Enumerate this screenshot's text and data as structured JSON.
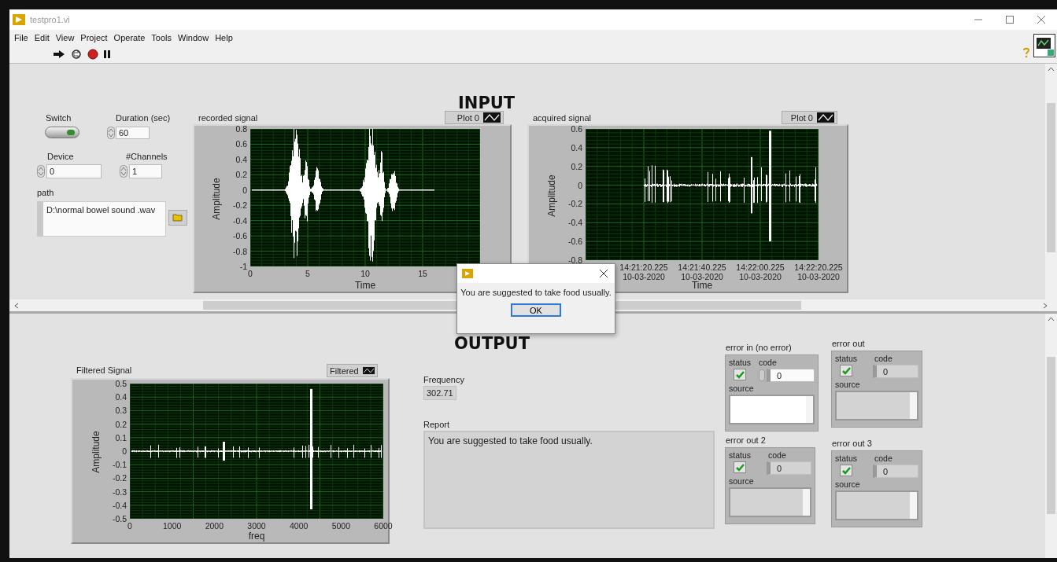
{
  "window": {
    "title": "testpro1.vi"
  },
  "menu": [
    "File",
    "Edit",
    "View",
    "Project",
    "Operate",
    "Tools",
    "Window",
    "Help"
  ],
  "input": {
    "heading": "INPUT",
    "switch": {
      "label": "Switch",
      "on": true
    },
    "duration": {
      "label": "Duration (sec)",
      "value": "60"
    },
    "device": {
      "label": "Device",
      "value": "0"
    },
    "channels": {
      "label": "#Channels",
      "value": "1"
    },
    "path": {
      "label": "path",
      "value": "D:\\normal bowel sound .wav"
    },
    "graphs": [
      {
        "label": "recorded signal",
        "legend": "Plot 0",
        "y_label": "Amplitude",
        "x_label": "Time",
        "kind": "bursts",
        "y_ticks": [
          "0.8",
          "0.6",
          "0.4",
          "0.2",
          "0",
          "-0.2",
          "-0.4",
          "-0.6",
          "-0.8",
          "-1"
        ],
        "x_ticks": [
          [
            "0"
          ],
          [
            "5"
          ],
          [
            "10"
          ],
          [
            "15"
          ]
        ]
      },
      {
        "label": "acquired signal",
        "legend": "Plot 0",
        "y_label": "Amplitude",
        "x_label": "Time",
        "kind": "sparse",
        "y_ticks": [
          "0.6",
          "0.4",
          "0.2",
          "0",
          "-0.2",
          "-0.4",
          "-0.6",
          "-0.8"
        ],
        "x_ticks": [
          [
            "14:21:20.225",
            "10-03-2020"
          ],
          [
            "14:21:40.225",
            "10-03-2020"
          ],
          [
            "14:22:00.225",
            "10-03-2020"
          ],
          [
            "14:22:20.225",
            "10-03-2020"
          ]
        ]
      }
    ]
  },
  "dialog": {
    "message": "You are suggested to take food usually.",
    "button": "OK"
  },
  "output": {
    "heading": "OUTPUT",
    "graph": {
      "label": "Filtered Signal",
      "legend": "Filtered",
      "y_label": "Amplitude",
      "x_label": "freq",
      "kind": "spike",
      "y_ticks": [
        "0.5",
        "0.4",
        "0.3",
        "0.2",
        "0.1",
        "0",
        "-0.1",
        "-0.2",
        "-0.3",
        "-0.4",
        "-0.5"
      ],
      "x_ticks": [
        [
          "0"
        ],
        [
          "1000"
        ],
        [
          "2000"
        ],
        [
          "3000"
        ],
        [
          "4000"
        ],
        [
          "5000"
        ],
        [
          "6000"
        ]
      ]
    },
    "frequency": {
      "label": "Frequency",
      "value": "302.71"
    },
    "report": {
      "label": "Report",
      "value": "You are suggested to take food usually."
    },
    "errors": [
      {
        "label": "error in (no error)",
        "kind": "control",
        "status_label": "status",
        "status": true,
        "code_label": "code",
        "code": "0",
        "source_label": "source"
      },
      {
        "label": "error out",
        "kind": "indicator",
        "status_label": "status",
        "status": true,
        "code_label": "code",
        "code": "0",
        "source_label": "source"
      },
      {
        "label": "error out 2",
        "kind": "indicator",
        "status_label": "status",
        "status": true,
        "code_label": "code",
        "code": "0",
        "source_label": "source"
      },
      {
        "label": "error out 3",
        "kind": "indicator",
        "status_label": "status",
        "status": true,
        "code_label": "code",
        "code": "0",
        "source_label": "source"
      }
    ]
  }
}
